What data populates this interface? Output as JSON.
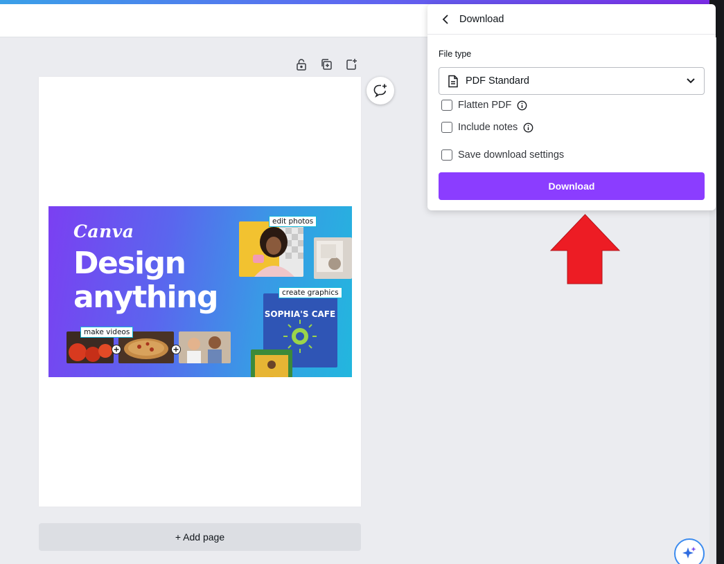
{
  "colors": {
    "accent": "#8b3dff",
    "arrow": "#ed1c24",
    "tag_border": "#13b8d8"
  },
  "toolbar": {
    "icons": [
      "lock-icon",
      "duplicate-page-icon",
      "add-page-icon"
    ]
  },
  "comment_button": {
    "icon": "add-comment-icon"
  },
  "design": {
    "logo_text": "Canva",
    "headline_line1": "Design",
    "headline_line2": "anything",
    "tags": {
      "edit_photos": "edit photos",
      "create_graphics": "create graphics",
      "make_videos": "make videos"
    },
    "cafe_text": "SOPHIA'S CAFE"
  },
  "add_page": {
    "label": "+ Add page"
  },
  "magic_button": {
    "icon": "magic-sparkle-icon"
  },
  "download_panel": {
    "title": "Download",
    "back_icon": "chevron-left-icon",
    "file_type_label": "File type",
    "file_type_value": "PDF Standard",
    "file_icon": "document-icon",
    "dropdown_icon": "chevron-down-icon",
    "options": {
      "flatten_pdf": {
        "label": "Flatten PDF",
        "checked": false,
        "has_info": true
      },
      "include_notes": {
        "label": "Include notes",
        "checked": false,
        "has_info": true
      },
      "save_settings": {
        "label": "Save download settings",
        "checked": false,
        "has_info": false
      }
    },
    "download_button": "Download"
  },
  "annotation": {
    "type": "arrow-up-icon"
  }
}
